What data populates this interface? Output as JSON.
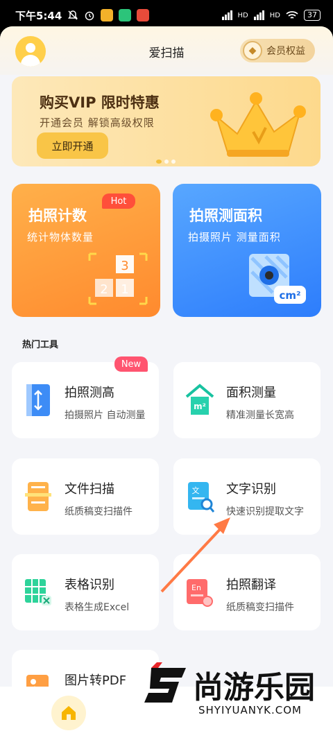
{
  "status": {
    "time": "下午5:44",
    "battery": "37",
    "network1": "HD",
    "network2": "HD"
  },
  "header": {
    "title": "爱扫描",
    "vip_label": "会员权益"
  },
  "banner": {
    "title": "购买VIP  限时特惠",
    "subtitle": "开通会员  解锁高级权限",
    "button": "立即开通"
  },
  "feature_cards": [
    {
      "title": "拍照计数",
      "subtitle": "统计物体数量",
      "badge": "Hot",
      "num1": "3",
      "num2": "2",
      "num3": "1"
    },
    {
      "title": "拍照测面积",
      "subtitle": "拍摄照片  测量面积",
      "unit": "cm²"
    }
  ],
  "section": {
    "title": "热门工具"
  },
  "tools": [
    {
      "title": "拍照测高",
      "subtitle": "拍摄照片 自动测量",
      "badge": "New"
    },
    {
      "title": "面积测量",
      "subtitle": "精准测量长宽高",
      "icon_text": "m²"
    },
    {
      "title": "文件扫描",
      "subtitle": "纸质稿变扫描件"
    },
    {
      "title": "文字识别",
      "subtitle": "快速识别提取文字",
      "icon_text": "文"
    },
    {
      "title": "表格识别",
      "subtitle": "表格生成Excel"
    },
    {
      "title": "拍照翻译",
      "subtitle": "纸质稿变扫描件",
      "icon_text": "En"
    },
    {
      "title": "图片转PDF",
      "subtitle": ""
    }
  ],
  "watermark": {
    "brand": "尚游乐园",
    "domain": "SHYIYUANYK.COM"
  },
  "colors": {
    "accent_orange": "#ff8a2e",
    "accent_blue": "#2d7dfc",
    "hot": "#ff4f3a",
    "new": "#ff5470"
  }
}
